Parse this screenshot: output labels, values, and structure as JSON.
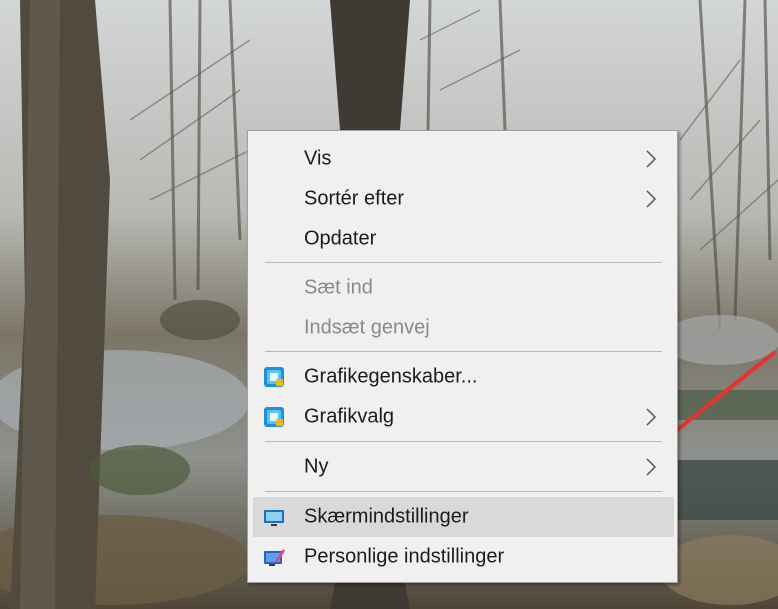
{
  "menu": {
    "items": [
      {
        "label": "Vis",
        "submenu": true
      },
      {
        "label": "Sortér efter",
        "submenu": true
      },
      {
        "label": "Opdater"
      },
      {
        "label": "Sæt ind",
        "disabled": true
      },
      {
        "label": "Indsæt genvej",
        "disabled": true
      },
      {
        "label": "Grafikegenskaber...",
        "icon": "intel-graphics-icon"
      },
      {
        "label": "Grafikvalg",
        "submenu": true,
        "icon": "intel-graphics-icon"
      },
      {
        "label": "Ny",
        "submenu": true
      },
      {
        "label": "Skærmindstillinger",
        "icon": "display-settings-icon",
        "highlighted": true
      },
      {
        "label": "Personlige indstillinger",
        "icon": "personalize-icon"
      }
    ]
  },
  "annotation": {
    "arrow_color": "#e8322b"
  },
  "colors": {
    "menu_bg": "#f0f0f0",
    "hover_bg": "#d9d9d9",
    "disabled_text": "#8a8a8a"
  }
}
